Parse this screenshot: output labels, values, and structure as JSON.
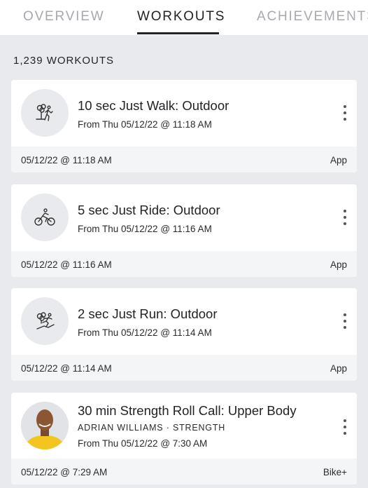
{
  "tabs": [
    {
      "label": "OVERVIEW",
      "active": false
    },
    {
      "label": "WORKOUTS",
      "active": true
    },
    {
      "label": "ACHIEVEMENTS",
      "active": false
    }
  ],
  "workout_count": "1,239 WORKOUTS",
  "workouts": [
    {
      "title": "10 sec Just Walk: Outdoor",
      "subtitle": "From Thu 05/12/22 @ 11:18 AM",
      "date": "05/12/22 @ 11:18 AM",
      "source": "App",
      "icon": "outdoor-walk-icon"
    },
    {
      "title": "5 sec Just Ride: Outdoor",
      "subtitle": "From Thu 05/12/22 @ 11:16 AM",
      "date": "05/12/22 @ 11:16 AM",
      "source": "App",
      "icon": "bike-icon"
    },
    {
      "title": "2 sec Just Run: Outdoor",
      "subtitle": "From Thu 05/12/22 @ 11:14 AM",
      "date": "05/12/22 @ 11:14 AM",
      "source": "App",
      "icon": "outdoor-run-icon"
    },
    {
      "title": "30 min Strength Roll Call: Upper Body",
      "instructor": "ADRIAN WILLIAMS  ·  STRENGTH",
      "subtitle": "From Thu 05/12/22 @ 7:30 AM",
      "date": "05/12/22 @ 7:29 AM",
      "source": "Bike+",
      "icon": "instructor-avatar"
    }
  ],
  "colors": {
    "background": "#e9eaee",
    "card": "#ffffff",
    "card_footer": "#f4f5f7",
    "active_tab": "#222326",
    "inactive_tab": "#a7a9ae"
  }
}
